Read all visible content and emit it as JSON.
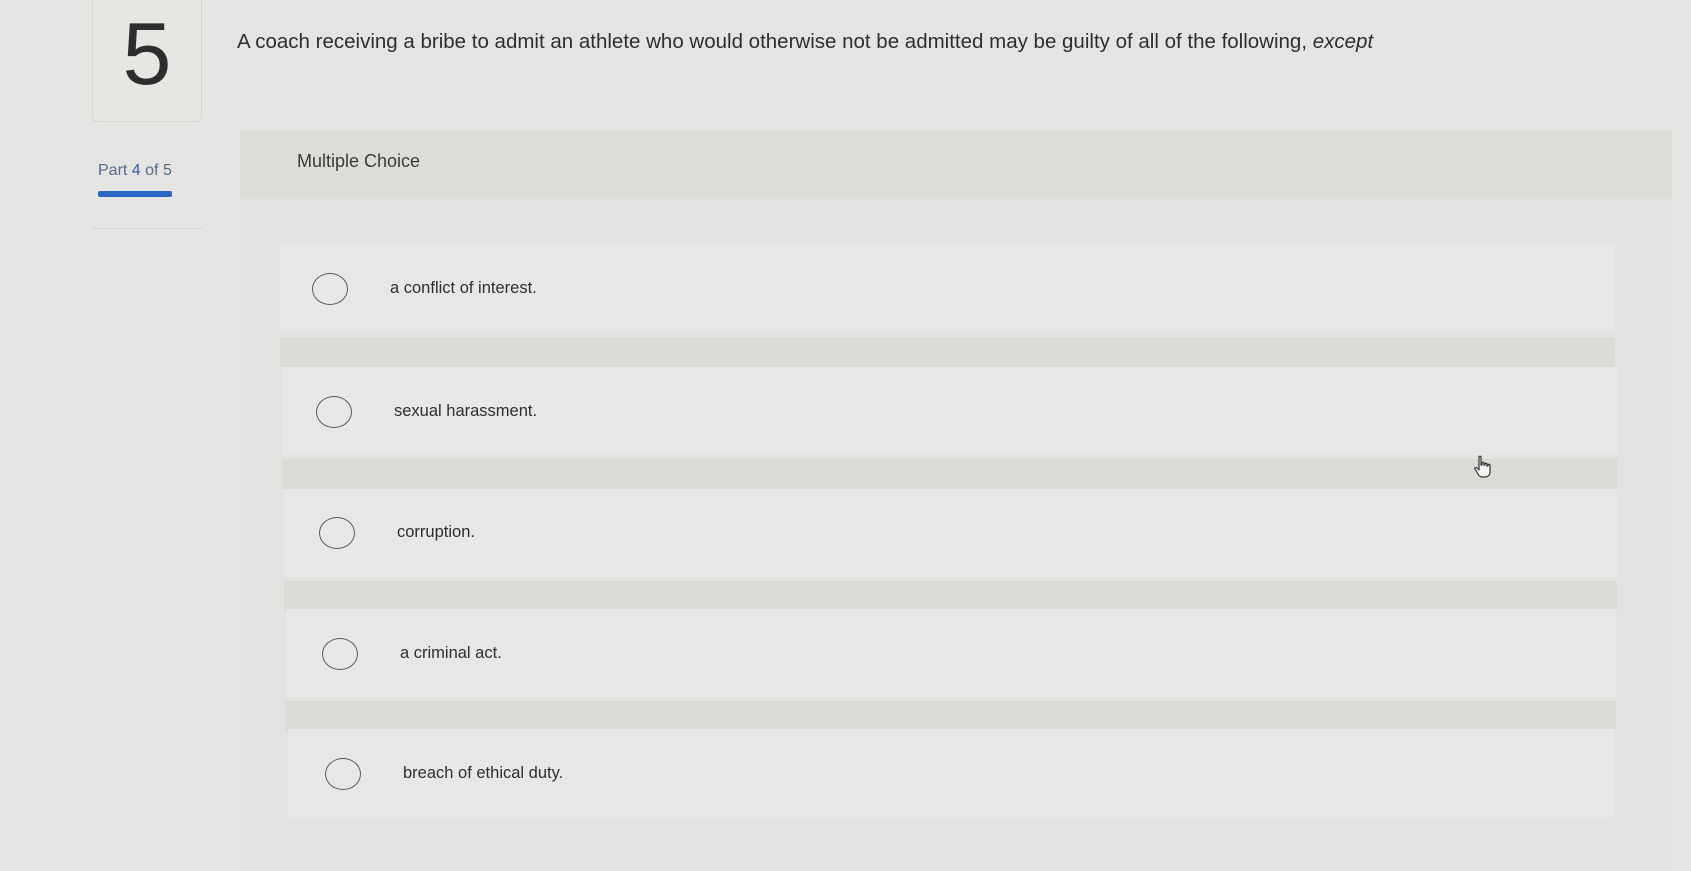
{
  "question": {
    "number": "5",
    "text": "A coach receiving a bribe to admit an athlete who would otherwise not be admitted may be guilty of all of the following,",
    "emphasis": "except"
  },
  "part": {
    "prefix": "Part",
    "current": "4",
    "separator": "of",
    "total": "5",
    "progress_fraction": 0.8
  },
  "choice": {
    "type_label": "Multiple Choice",
    "options": [
      {
        "label": "a conflict of interest.",
        "selected": false
      },
      {
        "label": "sexual harassment.",
        "selected": false
      },
      {
        "label": "corruption.",
        "selected": false
      },
      {
        "label": "a criminal act.",
        "selected": false
      },
      {
        "label": "breach of ethical duty.",
        "selected": false
      }
    ]
  },
  "colors": {
    "accent": "#2a67c2",
    "background": "#e4e4e2"
  },
  "icons": {
    "cursor": "hand-pointer-icon",
    "radio": "radio-button-icon"
  }
}
